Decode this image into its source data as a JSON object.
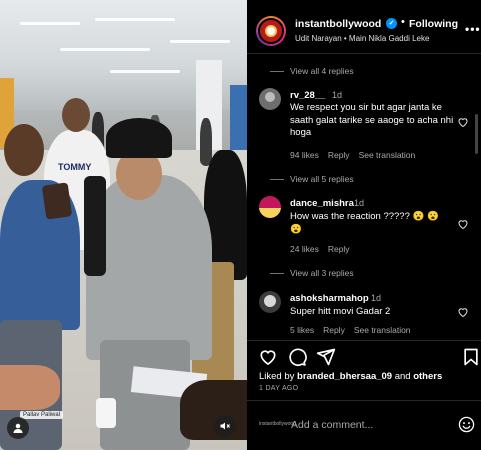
{
  "post": {
    "username": "instantbollywood",
    "verified_mark": "✓",
    "separator": "•",
    "follow_label": "Following",
    "audio": "Udit Narayan • Main Nikla Gaddi Leke",
    "more_icon": "more-icon"
  },
  "media": {
    "shirt_text": "TOMMY",
    "credit_tag": "Pallav Paliwal",
    "user_icon": "user-icon",
    "mute_icon": "mute-icon"
  },
  "comments": [
    {
      "type": "replies",
      "label": "View all 4 replies"
    },
    {
      "type": "comment",
      "user": "rv_28__",
      "time": "1d",
      "text": "We respect you sir but agar janta ke saath galat tarike se aaoge to acha nhi hoga",
      "likes": "94 likes",
      "reply": "Reply",
      "translate": "See translation"
    },
    {
      "type": "replies",
      "label": "View all 5 replies"
    },
    {
      "type": "comment",
      "user": "dance_mishra",
      "time": "1d",
      "text": "How was the reaction ????? 😮 😮 😮",
      "likes": "24 likes",
      "reply": "Reply"
    },
    {
      "type": "replies",
      "label": "View all 3 replies"
    },
    {
      "type": "comment",
      "user": "ashoksharmahop",
      "time": "1d",
      "text": "Super hitt movi Gadar 2",
      "likes": "5 likes",
      "reply": "Reply",
      "translate": "See translation"
    }
  ],
  "actions": {
    "like_icon": "heart-icon",
    "comment_icon": "comment-icon",
    "share_icon": "share-icon",
    "save_icon": "bookmark-icon",
    "liked_by_prefix": "Liked by",
    "liked_by_user": "branded_bhersaa_09",
    "liked_by_and": "and",
    "liked_by_others": "others",
    "posted": "1 DAY AGO"
  },
  "composer": {
    "logo_text": "instantbollywood",
    "placeholder": "Add a comment...",
    "emoji_icon": "emoji-icon"
  },
  "colors": {
    "background": "#000000",
    "verified": "#0095f6",
    "muted_text": "#a8a8a8"
  }
}
